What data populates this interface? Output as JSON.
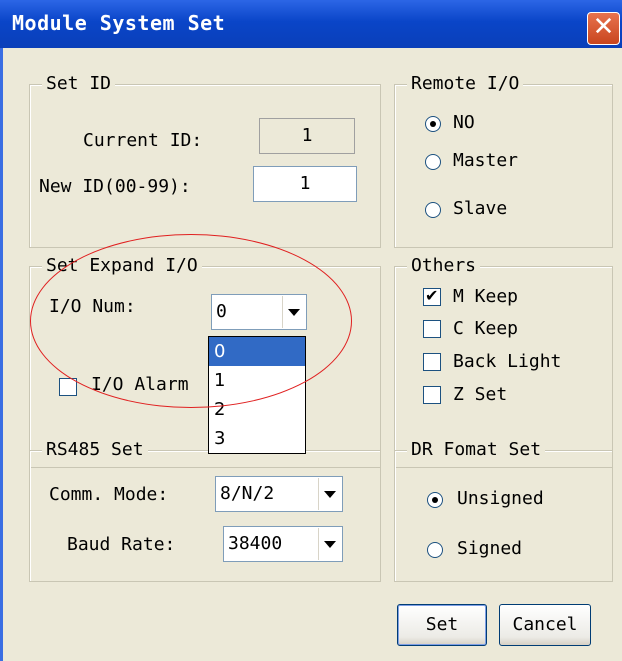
{
  "window": {
    "title": "Module System Set",
    "close_glyph": "✕"
  },
  "set_id": {
    "legend": "Set ID",
    "current_label": "Current ID:",
    "current_value": "1",
    "new_label": "New ID(00-99):",
    "new_value": "1"
  },
  "remote_io": {
    "legend": "Remote I/O",
    "options": [
      {
        "label": "NO",
        "checked": true
      },
      {
        "label": "Master",
        "checked": false
      },
      {
        "label": "Slave",
        "checked": false
      }
    ]
  },
  "expand_io": {
    "legend": "Set Expand I/O",
    "num_label": "I/O Num:",
    "num_value": "0",
    "alarm_label": "I/O Alarm",
    "alarm_checked": false,
    "dropdown_options": [
      "0",
      "1",
      "2",
      "3"
    ],
    "dropdown_selected": "0"
  },
  "others": {
    "legend": "Others",
    "items": [
      {
        "label": "M Keep",
        "checked": true
      },
      {
        "label": "C Keep",
        "checked": false
      },
      {
        "label": "Back Light",
        "checked": false
      },
      {
        "label": "Z Set",
        "checked": false
      }
    ]
  },
  "rs485": {
    "legend": "RS485 Set",
    "comm_label": "Comm. Mode:",
    "comm_value": "8/N/2",
    "baud_label": "Baud Rate:",
    "baud_value": "38400"
  },
  "dr_format": {
    "legend": "DR Fomat Set",
    "options": [
      {
        "label": "Unsigned",
        "checked": true
      },
      {
        "label": "Signed",
        "checked": false
      }
    ]
  },
  "buttons": {
    "set": "Set",
    "cancel": "Cancel"
  },
  "colors": {
    "titlebar": "#0a45c8",
    "dialog_bg": "#ece9d8",
    "highlight": "#316ac5",
    "annotation": "#e02020"
  }
}
